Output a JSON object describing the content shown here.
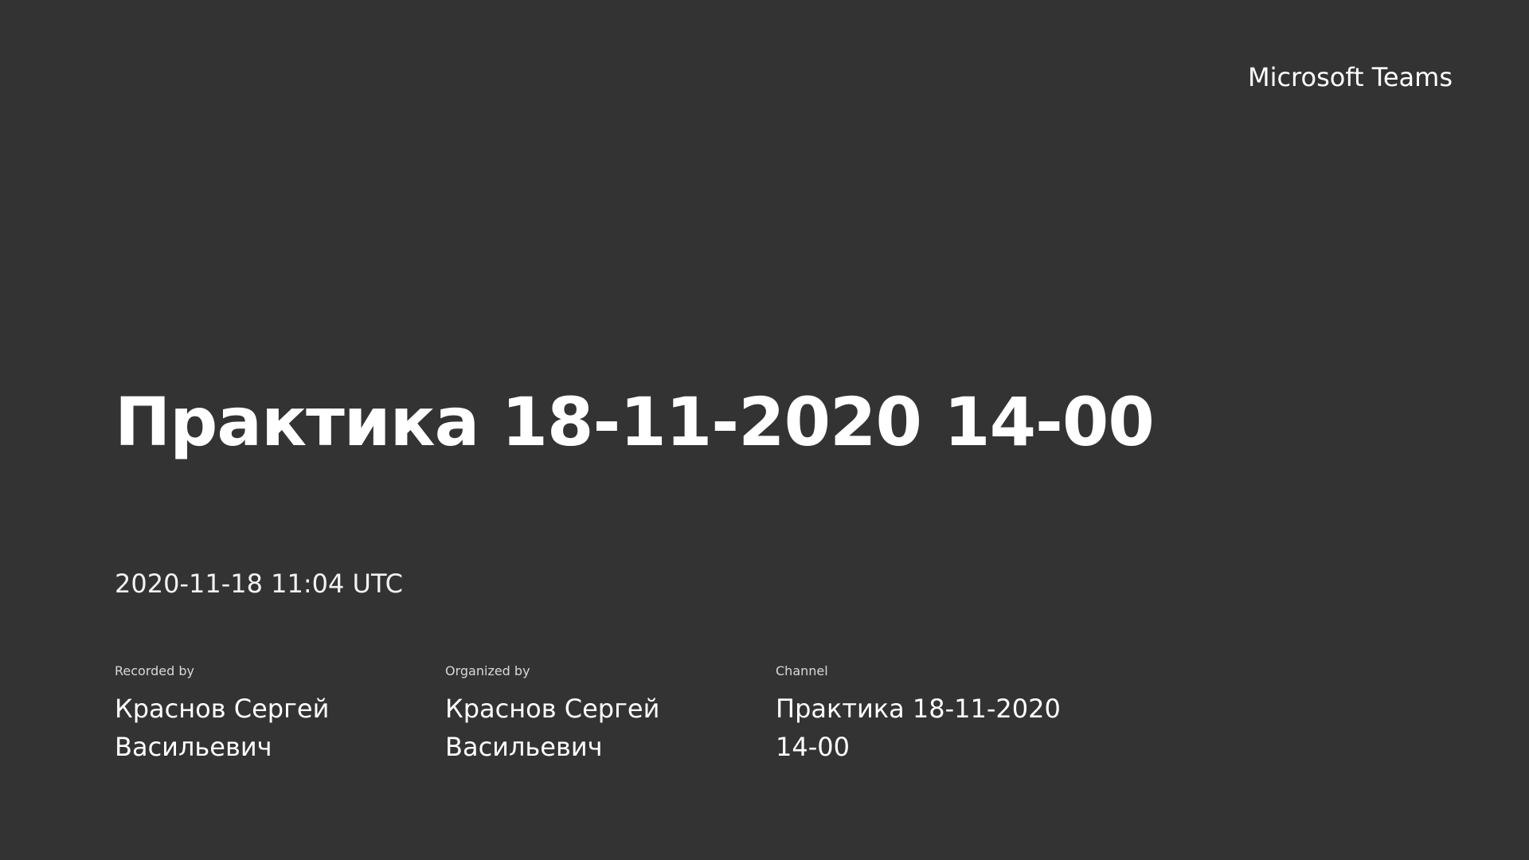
{
  "brand": {
    "name": "Microsoft Teams"
  },
  "recording": {
    "title": "Практика 18-11-2020 14-00",
    "timestamp": "2020-11-18 11:04 UTC"
  },
  "meta": {
    "recorded_by_label": "Recorded by",
    "recorded_by_value": "Краснов Сергей Васильевич",
    "organized_by_label": "Organized by",
    "organized_by_value": "Краснов Сергей Васильевич",
    "channel_label": "Channel",
    "channel_value": "Практика 18-11-2020 14-00"
  },
  "colors": {
    "background": "#333333",
    "text": "#ffffff"
  }
}
